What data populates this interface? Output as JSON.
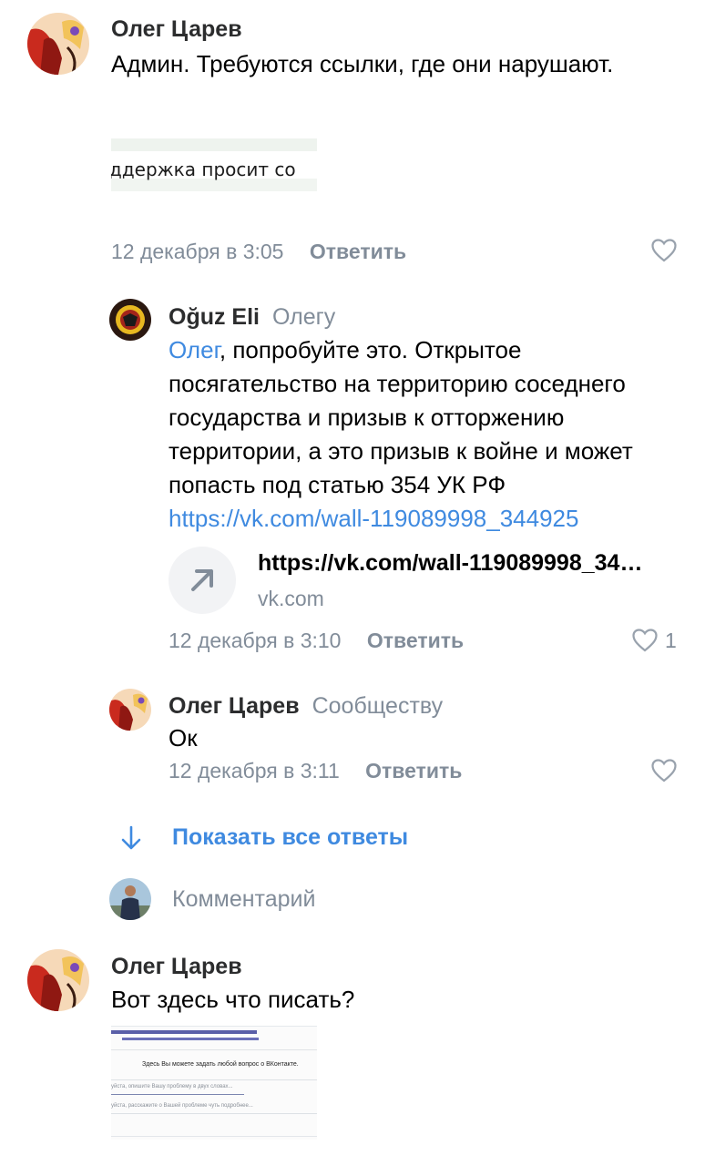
{
  "comments": [
    {
      "author": "Олег Царев",
      "text": "Админ. Требуются ссылки, где они нарушают.",
      "image_caption": "ддержка просит со",
      "date": "12 декабря в 3:05",
      "reply_label": "Ответить"
    },
    {
      "author": "Олег Царев",
      "text": "Вот здесь что писать?",
      "image_text": {
        "title": "Здесь Вы можете задать любой вопрос о ВКонтакте.",
        "field1": "уйста, опишите Вашу проблему в двух словах...",
        "field2": "уйста, расскажите о Вашей проблеме чуть подробнее..."
      }
    }
  ],
  "replies": [
    {
      "author": "Oğuz Eli",
      "reply_to": "Олегу",
      "mention": "Олег",
      "text": ", попробуйте это. Открытое посягательство на территорию соседнего государства и призыв к отторжению территории, а это призыв к войне и может попасть под статью 354 УК РФ",
      "link": "https://vk.com/wall-119089998_344925",
      "snippet_title": "https://vk.com/wall-119089998_34…",
      "snippet_domain": "vk.com",
      "date": "12 декабря в 3:10",
      "reply_label": "Ответить",
      "likes": "1"
    },
    {
      "author": "Олег Царев",
      "reply_to": "Сообществу",
      "text": "Ок",
      "date": "12 декабря в 3:11",
      "reply_label": "Ответить"
    }
  ],
  "show_all_replies": "Показать все ответы",
  "comment_input_placeholder": "Комментарий",
  "icons": {
    "like": "heart-icon",
    "snippet": "arrow-up-right-icon",
    "expand": "arrow-down-icon"
  },
  "colors": {
    "accent": "#3f8ae0",
    "secondary_text": "#818c99"
  }
}
